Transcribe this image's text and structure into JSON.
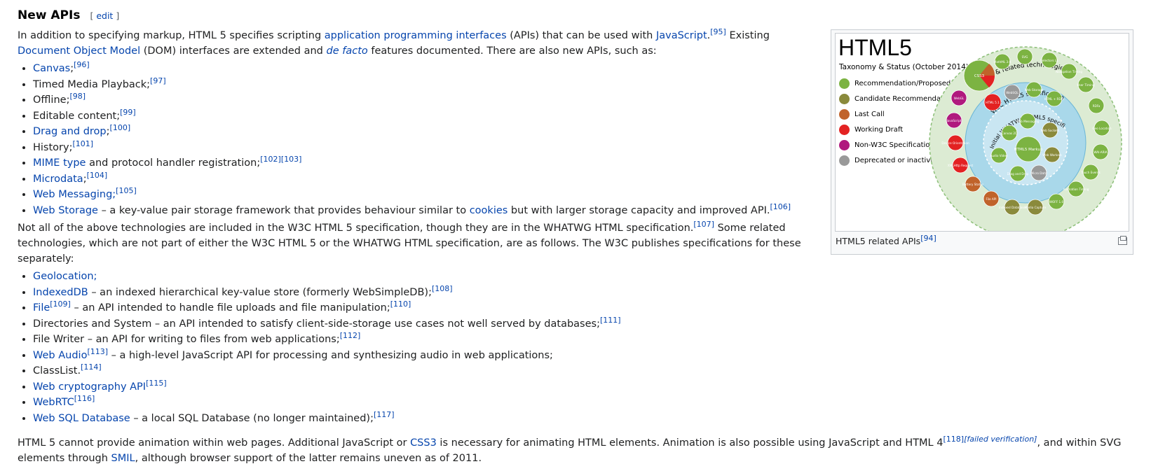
{
  "heading": {
    "title": "New APIs",
    "edit_open": "[",
    "edit_label": "edit",
    "edit_close": "]"
  },
  "intro": {
    "t1": "In addition to specifying markup, HTML 5 specifies scripting ",
    "l1": "application programming interfaces",
    "t2": " (APIs) that can be used with ",
    "l2": "JavaScript",
    "t3": ".",
    "r1": "[95]",
    "t4": " Existing ",
    "l3": "Document Object Model",
    "t5": " (DOM) interfaces are extended and ",
    "l4": "de facto",
    "t6": " features documented. There are also new APIs, such as:"
  },
  "list1": [
    {
      "link": "Canvas",
      "text": ";",
      "ref": "[96]"
    },
    {
      "link": "",
      "text": "Timed Media Playback;",
      "ref": "[97]"
    },
    {
      "link": "",
      "text": "Offline;",
      "ref": "[98]"
    },
    {
      "link": "",
      "text": "Editable content;",
      "ref": "[99]"
    },
    {
      "link": "Drag and drop",
      "text": ";",
      "ref": "[100]"
    },
    {
      "link": "",
      "text": "History;",
      "ref": "[101]"
    },
    {
      "link": "MIME type",
      "text": " and protocol handler registration;",
      "ref": "[102][103]"
    },
    {
      "link": "Microdata",
      "text": ";",
      "ref": "[104]"
    },
    {
      "link": "Web Messaging;",
      "text": "",
      "ref": "[105]"
    },
    {
      "link": "Web Storage",
      "text": " – a key-value pair storage framework that provides behaviour similar to ",
      "link2": "cookies",
      "text2": " but with larger storage capacity and improved API.",
      "ref": "[106]"
    }
  ],
  "middle": {
    "t1": "Not all of the above technologies are included in the W3C HTML 5 specification, though they are in the WHATWG HTML specification.",
    "r1": "[107]",
    "t2": " Some related technologies, which are not part of either the W3C HTML 5 or the WHATWG HTML specification, are as follows. The W3C publishes specifications for these separately:"
  },
  "list2": [
    {
      "link": "Geolocation;",
      "text": "",
      "ref": ""
    },
    {
      "link": "IndexedDB",
      "text": " – an indexed hierarchical key-value store (formerly WebSimpleDB);",
      "ref": "[108]"
    },
    {
      "link": "File",
      "ref_a": "[109]",
      "text": " – an API intended to handle file uploads and file manipulation;",
      "ref": "[110]"
    },
    {
      "link": "",
      "text": "Directories and System – an API intended to satisfy client-side-storage use cases not well served by databases;",
      "ref": "[111]"
    },
    {
      "link": "",
      "text": "File Writer – an API for writing to files from web applications;",
      "ref": "[112]"
    },
    {
      "link": "Web Audio",
      "ref_a": "[113]",
      "text": " – a high-level JavaScript API for processing and synthesizing audio in web applications;",
      "ref": ""
    },
    {
      "link": "",
      "text": "ClassList.",
      "ref": "[114]"
    },
    {
      "link": "Web cryptography API",
      "text": "",
      "ref": "[115]"
    },
    {
      "link": "WebRTC",
      "text": "",
      "ref": "[116]"
    },
    {
      "link": "Web SQL Database",
      "text": " – a local SQL Database (no longer maintained);",
      "ref": "[117]"
    }
  ],
  "after": {
    "t1": "HTML 5 cannot provide animation within web pages. Additional JavaScript or ",
    "l1": "CSS3",
    "t2": " is necessary for animating HTML elements. Animation is also possible using JavaScript and HTML 4",
    "r1": "[118]",
    "r2": "[failed verification]",
    "t3": ", and within SVG elements through ",
    "l2": "SMIL",
    "t4": ", although browser support of the latter remains uneven as of 2011."
  },
  "figure": {
    "caption": "HTML5 related APIs",
    "caption_ref": "[94]",
    "diagram": {
      "title": "HTML5",
      "subtitle": "Taxonomy & Status (October 2014)",
      "legend": [
        {
          "label": "Recommendation/Proposed",
          "color": "#7cb342"
        },
        {
          "label": "Candidate Recommendation",
          "color": "#8a8a3c"
        },
        {
          "label": "Last Call",
          "color": "#c0632b"
        },
        {
          "label": "Working Draft",
          "color": "#e32222"
        },
        {
          "label": "Non-W3C Specifications",
          "color": "#b0197e"
        },
        {
          "label": "Deprecated or inactive",
          "color": "#999999"
        }
      ],
      "ring_labels": {
        "outer": "HTML5 & related technologies",
        "middle": "W3C HTML5 specification",
        "inner": "Initial WHATWG HTML5 specification"
      },
      "nodes": [
        {
          "label": "CSS3",
          "color": "#7cb342"
        },
        {
          "label": "MathML 3.0",
          "color": "#7cb342"
        },
        {
          "label": "SVG",
          "color": "#7cb342"
        },
        {
          "label": "Selectors L1",
          "color": "#7cb342"
        },
        {
          "label": "Navigation Timing",
          "color": "#7cb342"
        },
        {
          "label": "User Timing",
          "color": "#7cb342"
        },
        {
          "label": "RDFa",
          "color": "#7cb342"
        },
        {
          "label": "Geo Location",
          "color": "#7cb342"
        },
        {
          "label": "WAI-ARIA",
          "color": "#7cb342"
        },
        {
          "label": "Touch Events",
          "color": "#7cb342"
        },
        {
          "label": "Animation Timing",
          "color": "#7cb342"
        },
        {
          "label": "WOFF 1.0",
          "color": "#7cb342"
        },
        {
          "label": "Media Capture",
          "color": "#8a8a3c"
        },
        {
          "label": "Indexed Database",
          "color": "#8a8a3c"
        },
        {
          "label": "File API",
          "color": "#c0632b"
        },
        {
          "label": "Battery Status",
          "color": "#c0632b"
        },
        {
          "label": "XMLHttp Request",
          "color": "#e32222"
        },
        {
          "label": "Device Orientation",
          "color": "#e32222"
        },
        {
          "label": "JavaScript",
          "color": "#b0197e"
        },
        {
          "label": "WebGL",
          "color": "#b0197e"
        },
        {
          "label": "HTML 5.1",
          "color": "#e32222"
        },
        {
          "label": "WebSQL",
          "color": "#999999"
        },
        {
          "label": "Web Storage",
          "color": "#7cb342"
        },
        {
          "label": "HTML + RDFa",
          "color": "#7cb342"
        },
        {
          "label": "Web Messaging",
          "color": "#7cb342"
        },
        {
          "label": "Canvas 2D",
          "color": "#7cb342"
        },
        {
          "label": "Web Sockets",
          "color": "#8a8a3c"
        },
        {
          "label": "HTML5 Markup",
          "color": "#7cb342"
        },
        {
          "label": "Audio Video",
          "color": "#7cb342"
        },
        {
          "label": "Web Workers",
          "color": "#8a8a3c"
        },
        {
          "label": "Drag and Drop",
          "color": "#7cb342"
        },
        {
          "label": "Micro Data",
          "color": "#999999"
        }
      ]
    }
  }
}
